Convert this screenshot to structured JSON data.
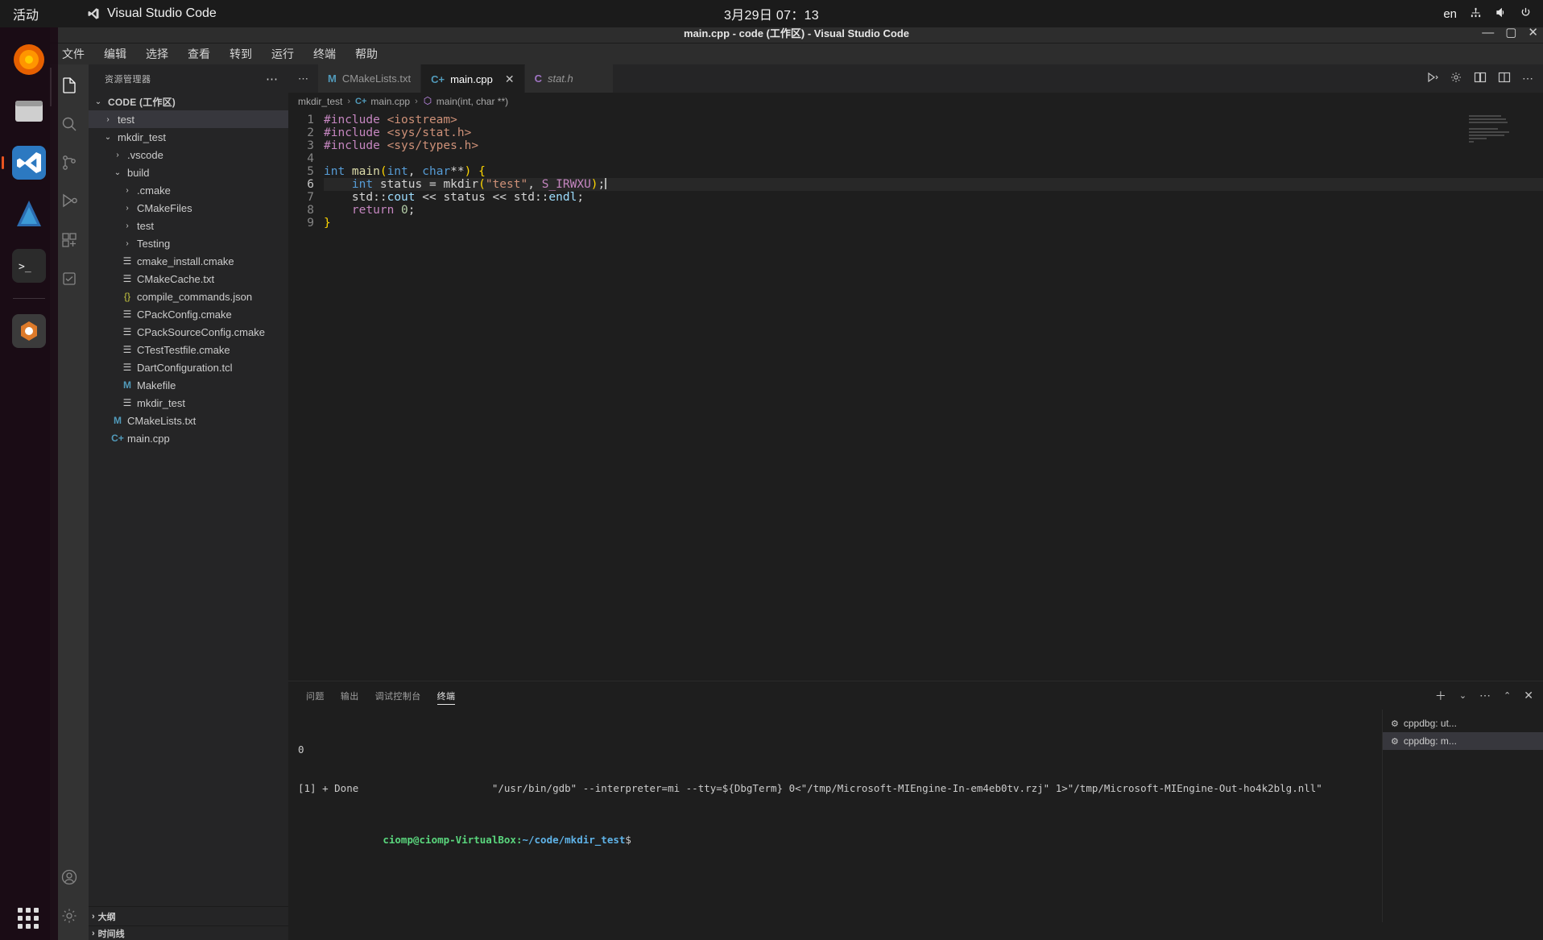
{
  "os_panel": {
    "activities": "活动",
    "app_name": "Visual Studio Code",
    "app_icon": "vscode-logo-icon",
    "clock": "3月29日 07：13",
    "tray": {
      "input_language": "en",
      "network_icon": "network-icon",
      "volume_icon": "volume-icon",
      "power_icon": "power-icon"
    }
  },
  "dock": {
    "items": [
      {
        "name": "firefox",
        "icon": "firefox-icon"
      },
      {
        "name": "files",
        "icon": "files-icon"
      },
      {
        "name": "vscode",
        "icon": "vscode-icon",
        "active": true
      },
      {
        "name": "firefox-dev",
        "icon": "firefox-developer-icon"
      },
      {
        "name": "terminal",
        "icon": "terminal-icon"
      },
      {
        "name": "software",
        "icon": "ubuntu-software-icon"
      },
      {
        "name": "trash",
        "icon": "trash-icon"
      }
    ],
    "show_apps_label": "show-applications"
  },
  "window": {
    "title": "main.cpp - code (工作区) - Visual Studio Code",
    "minimize": "—",
    "maximize": "▢",
    "close": "✕"
  },
  "menubar": {
    "items": [
      "文件",
      "编辑",
      "选择",
      "查看",
      "转到",
      "运行",
      "终端",
      "帮助"
    ]
  },
  "activitybar": {
    "items": [
      {
        "name": "explorer",
        "icon": "files-explorer-icon",
        "active": true
      },
      {
        "name": "search",
        "icon": "search-icon",
        "active": false
      },
      {
        "name": "source-control",
        "icon": "source-control-icon",
        "active": false
      },
      {
        "name": "run-and-debug",
        "icon": "run-debug-icon",
        "active": false
      },
      {
        "name": "extensions",
        "icon": "extensions-icon",
        "active": false
      },
      {
        "name": "testing",
        "icon": "testing-beaker-icon",
        "active": false
      }
    ],
    "bottom": [
      {
        "name": "accounts",
        "icon": "account-icon"
      },
      {
        "name": "manage",
        "icon": "gear-icon"
      }
    ]
  },
  "sidebar": {
    "title": "资源管理器",
    "more_actions": "⋯",
    "root": {
      "label": "CODE (工作区)",
      "expanded": true
    },
    "tree": [
      {
        "label": "test",
        "indent": 1,
        "type": "folder",
        "state": "collapsed",
        "selected": true
      },
      {
        "label": "mkdir_test",
        "indent": 1,
        "type": "folder",
        "state": "expanded",
        "selected": false
      },
      {
        "label": ".vscode",
        "indent": 2,
        "type": "folder",
        "state": "collapsed",
        "selected": false
      },
      {
        "label": "build",
        "indent": 2,
        "type": "folder",
        "state": "expanded",
        "selected": false
      },
      {
        "label": ".cmake",
        "indent": 3,
        "type": "folder",
        "state": "collapsed",
        "selected": false
      },
      {
        "label": "CMakeFiles",
        "indent": 3,
        "type": "folder",
        "state": "collapsed",
        "selected": false
      },
      {
        "label": "test",
        "indent": 3,
        "type": "folder",
        "state": "collapsed",
        "selected": false
      },
      {
        "label": "Testing",
        "indent": 3,
        "type": "folder",
        "state": "collapsed",
        "selected": false
      },
      {
        "label": "cmake_install.cmake",
        "indent": 3,
        "type": "file",
        "icon": "cmake-file-icon",
        "selected": false
      },
      {
        "label": "CMakeCache.txt",
        "indent": 3,
        "type": "file",
        "icon": "cmake-file-icon",
        "selected": false
      },
      {
        "label": "compile_commands.json",
        "indent": 3,
        "type": "file",
        "icon": "json-file-icon",
        "selected": false
      },
      {
        "label": "CPackConfig.cmake",
        "indent": 3,
        "type": "file",
        "icon": "cmake-file-icon",
        "selected": false
      },
      {
        "label": "CPackSourceConfig.cmake",
        "indent": 3,
        "type": "file",
        "icon": "cmake-file-icon",
        "selected": false
      },
      {
        "label": "CTestTestfile.cmake",
        "indent": 3,
        "type": "file",
        "icon": "cmake-file-icon",
        "selected": false
      },
      {
        "label": "DartConfiguration.tcl",
        "indent": 3,
        "type": "file",
        "icon": "config-file-icon",
        "selected": false
      },
      {
        "label": "Makefile",
        "indent": 3,
        "type": "file",
        "icon": "makefile-icon",
        "selected": false
      },
      {
        "label": "mkdir_test",
        "indent": 3,
        "type": "file",
        "icon": "binary-file-icon",
        "selected": false
      },
      {
        "label": "CMakeLists.txt",
        "indent": 2,
        "type": "file",
        "icon": "makefile-icon",
        "selected": false
      },
      {
        "label": "main.cpp",
        "indent": 2,
        "type": "file",
        "icon": "cpp-file-icon",
        "selected": false
      }
    ],
    "sections": [
      {
        "label": "大纲",
        "expanded": false
      },
      {
        "label": "时间线",
        "expanded": false
      }
    ]
  },
  "editor": {
    "tabs": [
      {
        "label": "CMakeLists.txt",
        "icon": "makefile-icon",
        "icon_glyph": "M",
        "active": false,
        "preview": false,
        "closable": false
      },
      {
        "label": "main.cpp",
        "icon": "cpp-file-icon",
        "icon_glyph": "C+",
        "active": true,
        "preview": false,
        "closable": true
      },
      {
        "label": "stat.h",
        "icon": "c-header-icon",
        "icon_glyph": "C",
        "active": false,
        "preview": true,
        "closable": false
      }
    ],
    "tab_overflow": "⋯",
    "actions": [
      {
        "name": "run-or-debug",
        "icon": "run-play-icon"
      },
      {
        "name": "open-settings",
        "icon": "gear-icon"
      },
      {
        "name": "open-changes",
        "icon": "open-changes-icon"
      },
      {
        "name": "split-editor",
        "icon": "split-editor-icon"
      },
      {
        "name": "more-actions",
        "icon": "ellipsis-icon"
      }
    ],
    "breadcrumb": [
      {
        "label": "mkdir_test",
        "icon": "folder-icon"
      },
      {
        "label": "main.cpp",
        "icon": "cpp-file-icon"
      },
      {
        "label": "main(int, char **)",
        "icon": "symbol-method-icon"
      }
    ],
    "line_numbers": [
      "1",
      "2",
      "3",
      "4",
      "5",
      "6",
      "7",
      "8",
      "9"
    ],
    "current_line": 6,
    "code_lines": [
      {
        "n": 1,
        "tokens": [
          {
            "t": "#include ",
            "c": "c-pre"
          },
          {
            "t": "<iostream>",
            "c": "c-str"
          }
        ]
      },
      {
        "n": 2,
        "tokens": [
          {
            "t": "#include ",
            "c": "c-pre"
          },
          {
            "t": "<sys/stat.h>",
            "c": "c-str"
          }
        ]
      },
      {
        "n": 3,
        "tokens": [
          {
            "t": "#include ",
            "c": "c-pre"
          },
          {
            "t": "<sys/types.h>",
            "c": "c-str"
          }
        ]
      },
      {
        "n": 4,
        "tokens": []
      },
      {
        "n": 5,
        "tokens": [
          {
            "t": "int ",
            "c": "c-kw"
          },
          {
            "t": "main",
            "c": "c-fn"
          },
          {
            "t": "(",
            "c": "c-par"
          },
          {
            "t": "int",
            "c": "c-kw"
          },
          {
            "t": ", ",
            "c": "c-plain"
          },
          {
            "t": "char",
            "c": "c-kw"
          },
          {
            "t": "**",
            "c": "c-plain"
          },
          {
            "t": ")",
            "c": "c-par"
          },
          {
            "t": " ",
            "c": "c-plain"
          },
          {
            "t": "{",
            "c": "c-par"
          }
        ]
      },
      {
        "n": 6,
        "tokens": [
          {
            "t": "    ",
            "c": "c-plain"
          },
          {
            "t": "int ",
            "c": "c-kw"
          },
          {
            "t": "status",
            "c": "c-plain"
          },
          {
            "t": " = ",
            "c": "c-plain"
          },
          {
            "t": "mkdir",
            "c": "c-plain"
          },
          {
            "t": "(",
            "c": "c-par"
          },
          {
            "t": "\"test\"",
            "c": "c-str"
          },
          {
            "t": ", ",
            "c": "c-plain"
          },
          {
            "t": "S_IRWXU",
            "c": "c-const"
          },
          {
            "t": ")",
            "c": "c-par"
          },
          {
            "t": ";",
            "c": "c-plain"
          }
        ]
      },
      {
        "n": 7,
        "tokens": [
          {
            "t": "    ",
            "c": "c-plain"
          },
          {
            "t": "std",
            "c": "c-plain"
          },
          {
            "t": "::",
            "c": "c-plain"
          },
          {
            "t": "cout",
            "c": "c-var"
          },
          {
            "t": " << ",
            "c": "c-plain"
          },
          {
            "t": "status",
            "c": "c-plain"
          },
          {
            "t": " << ",
            "c": "c-plain"
          },
          {
            "t": "std",
            "c": "c-plain"
          },
          {
            "t": "::",
            "c": "c-plain"
          },
          {
            "t": "endl",
            "c": "c-var"
          },
          {
            "t": ";",
            "c": "c-plain"
          }
        ]
      },
      {
        "n": 8,
        "tokens": [
          {
            "t": "    ",
            "c": "c-plain"
          },
          {
            "t": "return ",
            "c": "c-pre"
          },
          {
            "t": "0",
            "c": "c-num"
          },
          {
            "t": ";",
            "c": "c-plain"
          }
        ]
      },
      {
        "n": 9,
        "tokens": [
          {
            "t": "}",
            "c": "c-par"
          }
        ]
      }
    ],
    "raw_source": "#include <iostream>\n#include <sys/stat.h>\n#include <sys/types.h>\n\nint main(int, char**) {\n    int status = mkdir(\"test\", S_IRWXU);\n    std::cout << status << std::endl;\n    return 0;\n}"
  },
  "panel": {
    "tabs": [
      {
        "label": "问题",
        "active": false
      },
      {
        "label": "输出",
        "active": false
      },
      {
        "label": "调试控制台",
        "active": false
      },
      {
        "label": "终端",
        "active": true
      }
    ],
    "actions": [
      {
        "name": "new-terminal",
        "icon": "plus-icon"
      },
      {
        "name": "terminal-dropdown",
        "icon": "chevron-down-icon"
      },
      {
        "name": "panel-more",
        "icon": "ellipsis-icon"
      },
      {
        "name": "maximize-panel",
        "icon": "chevron-up-icon"
      },
      {
        "name": "close-panel",
        "icon": "close-icon"
      }
    ],
    "terminal_lines": [
      {
        "text": "0",
        "type": "plain"
      },
      {
        "text": "[1] + Done                      \"/usr/bin/gdb\" --interpreter=mi --tty=${DbgTerm} 0<\"/tmp/Microsoft-MIEngine-In-em4eb0tv.rzj\" 1>\"/tmp/Microsoft-MIEngine-Out-ho4k2blg.nll\"",
        "type": "plain"
      }
    ],
    "prompt": {
      "user_host": "ciomp@ciomp-VirtualBox",
      "separator": ":",
      "path": "~/code/mkdir_test",
      "symbol": "$"
    },
    "terminal_list": [
      {
        "label": "cppdbg: ut...",
        "icon": "gear-icon",
        "active": false
      },
      {
        "label": "cppdbg: m...",
        "icon": "gear-icon",
        "active": true
      }
    ]
  }
}
